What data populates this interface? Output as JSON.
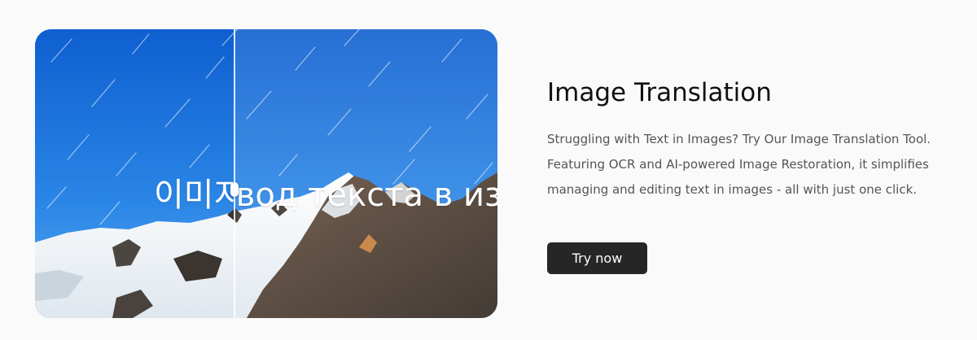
{
  "feature": {
    "title": "Image Translation",
    "description": "Struggling with Text in Images? Try Our Image Translation Tool. Featuring OCR and AI-powered Image Restoration, it simplifies managing and editing text in images - all with just one click.",
    "cta_label": "Try now"
  },
  "image_preview": {
    "before_text": "이미지 번역",
    "after_text": "перевод текста в изображении"
  },
  "colors": {
    "sky": "#1c6fd6",
    "button": "#262626",
    "title": "#111111",
    "body_text": "#555555"
  }
}
